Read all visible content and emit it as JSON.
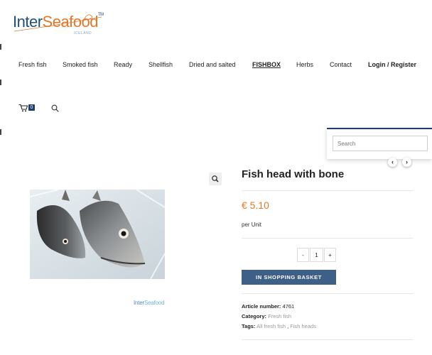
{
  "logo": {
    "inter": "Inter",
    "seafood": "Seafood",
    "tm": "TM",
    "sub": "ICELAND"
  },
  "nav": {
    "items": [
      "Fresh fish",
      "Smoked fish",
      "Ready",
      "Shellfish",
      "Dried and salted",
      "FISHBOX",
      "Herbs",
      "Contact",
      "Login / Register"
    ]
  },
  "cart": {
    "count": "0"
  },
  "search": {
    "placeholder": "Search"
  },
  "carousel": {
    "prev": "‹",
    "next": "›"
  },
  "watermark": {
    "inter": "Inter",
    "seafood": "Seafood"
  },
  "product": {
    "title": "Fish head with bone",
    "price": "€ 5.10",
    "unit": "per Unit",
    "qty_minus": "-",
    "qty_value": "1",
    "qty_plus": "+",
    "basket_label": "IN SHOPPING BASKET",
    "article_label": "Article number:",
    "article_value": "4761",
    "category_label": "Category:",
    "category_value": "Fresh fish",
    "tags_label": "Tags:",
    "tag1": "All fresh fish",
    "tag_sep": ",",
    "tag2": "Fish heads"
  },
  "colors": {
    "brand_blue": "#20507e",
    "accent_orange": "#e2782c",
    "button": "#3e5f86",
    "dark_navy": "#1f3d66"
  }
}
